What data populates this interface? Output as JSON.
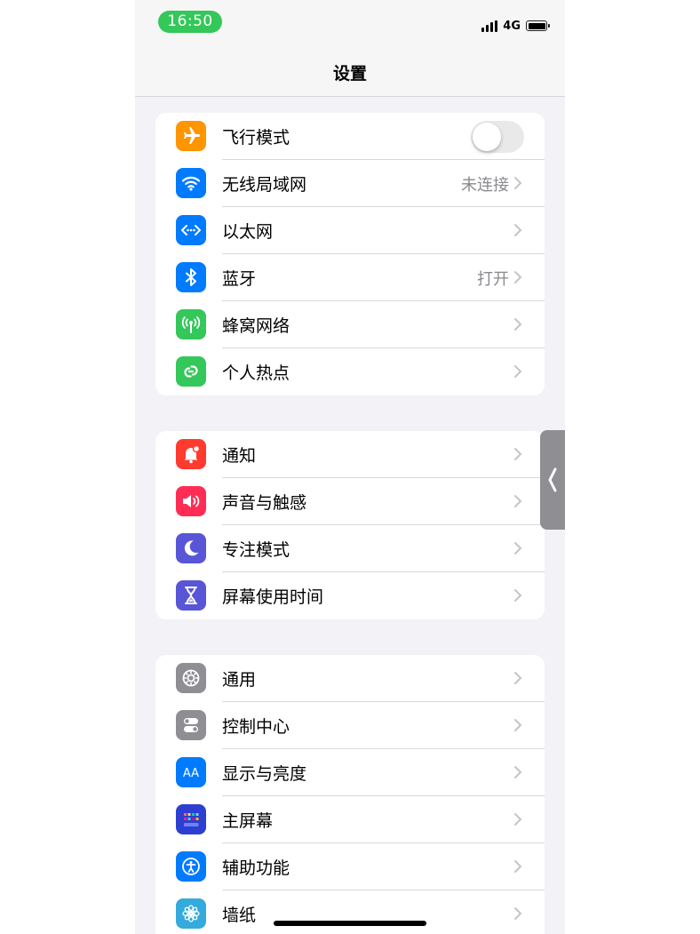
{
  "status_bar": {
    "time": "16:50",
    "network": "4G"
  },
  "header": {
    "title": "设置"
  },
  "groups": [
    {
      "items": [
        {
          "label": "飞行模式",
          "icon": "airplane-icon",
          "color": "#ff9500",
          "toggle": false
        },
        {
          "label": "无线局域网",
          "value": "未连接",
          "icon": "wifi-icon",
          "color": "#007aff"
        },
        {
          "label": "以太网",
          "icon": "ethernet-icon",
          "color": "#007aff"
        },
        {
          "label": "蓝牙",
          "value": "打开",
          "icon": "bluetooth-icon",
          "color": "#007aff"
        },
        {
          "label": "蜂窝网络",
          "icon": "cellular-icon",
          "color": "#34c759"
        },
        {
          "label": "个人热点",
          "icon": "hotspot-icon",
          "color": "#34c759"
        }
      ]
    },
    {
      "items": [
        {
          "label": "通知",
          "icon": "notification-bell-icon",
          "color": "#ff3b30"
        },
        {
          "label": "声音与触感",
          "icon": "speaker-icon",
          "color": "#ff2d55"
        },
        {
          "label": "专注模式",
          "icon": "moon-icon",
          "color": "#5856d6"
        },
        {
          "label": "屏幕使用时间",
          "icon": "hourglass-icon",
          "color": "#5856d6"
        }
      ]
    },
    {
      "items": [
        {
          "label": "通用",
          "icon": "gear-icon",
          "color": "#8e8e93"
        },
        {
          "label": "控制中心",
          "icon": "switches-icon",
          "color": "#8e8e93"
        },
        {
          "label": "显示与亮度",
          "icon": "text-size-icon",
          "color": "#007aff"
        },
        {
          "label": "主屏幕",
          "icon": "home-screen-grid-icon",
          "color": "#2c3fd1"
        },
        {
          "label": "辅助功能",
          "icon": "accessibility-icon",
          "color": "#007aff"
        },
        {
          "label": "墙纸",
          "icon": "flower-icon",
          "color": "#35aadc"
        }
      ]
    }
  ]
}
